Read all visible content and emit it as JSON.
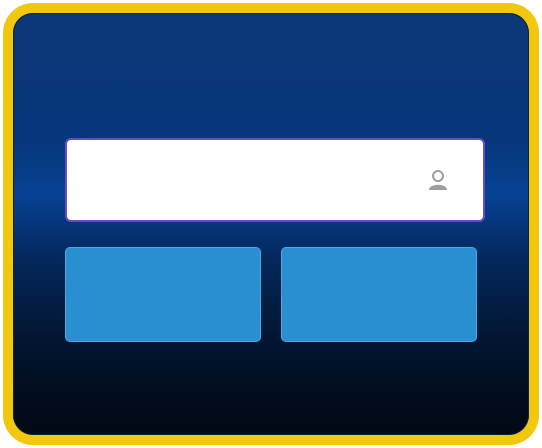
{
  "login": {
    "username_field": {
      "value": "",
      "placeholder": "",
      "icon": "user-icon"
    },
    "buttons": [
      {
        "label": ""
      },
      {
        "label": ""
      }
    ]
  },
  "colors": {
    "frame_border": "#f2c80f",
    "panel_top": "#0b3878",
    "panel_bottom": "#020914",
    "field_border": "#6a4bc7",
    "button_fill": "#2a8fd1",
    "icon_gray": "#9e9e9e"
  }
}
